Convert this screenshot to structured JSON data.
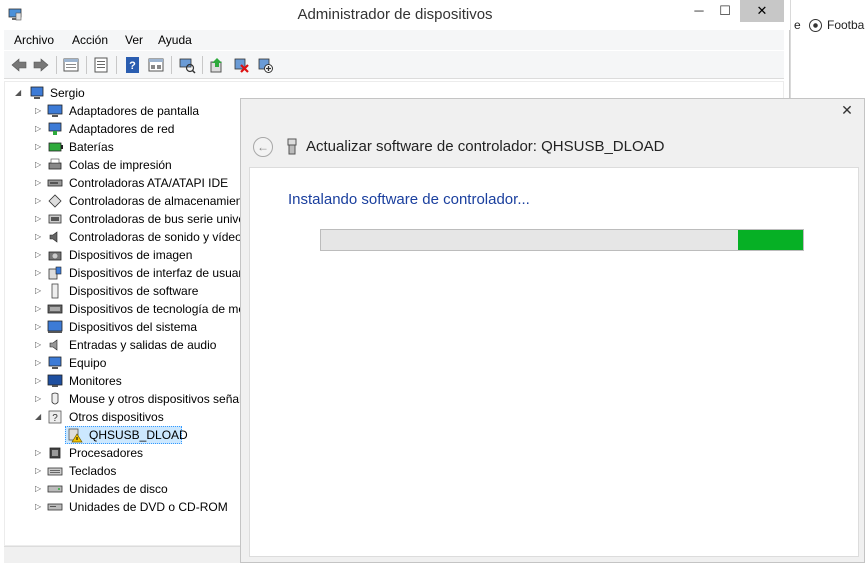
{
  "window": {
    "title": "Administrador de dispositivos",
    "min_glyph": "─",
    "max_glyph": "☐",
    "close_glyph": "✕"
  },
  "menu": [
    "Archivo",
    "Acción",
    "Ver",
    "Ayuda"
  ],
  "toolbar_icons": [
    "back-icon",
    "forward-icon",
    "properties-icon",
    "help-icon",
    "scan-hardware-icon",
    "update-driver-icon",
    "uninstall-icon",
    "disable-icon"
  ],
  "tree": {
    "root": "Sergio",
    "items": [
      {
        "label": "Adaptadores de pantalla",
        "icon": "display-adapter-icon"
      },
      {
        "label": "Adaptadores de red",
        "icon": "network-adapter-icon"
      },
      {
        "label": "Baterías",
        "icon": "battery-icon"
      },
      {
        "label": "Colas de impresión",
        "icon": "printer-icon"
      },
      {
        "label": "Controladoras ATA/ATAPI IDE",
        "icon": "ide-controller-icon"
      },
      {
        "label": "Controladoras de almacenamiento",
        "icon": "storage-controller-icon"
      },
      {
        "label": "Controladoras de bus serie universal",
        "icon": "usb-controller-icon"
      },
      {
        "label": "Controladoras de sonido y vídeo y dispositivos de juego",
        "icon": "sound-icon"
      },
      {
        "label": "Dispositivos de imagen",
        "icon": "camera-icon"
      },
      {
        "label": "Dispositivos de interfaz de usuario (HID)",
        "icon": "hid-icon"
      },
      {
        "label": "Dispositivos de software",
        "icon": "software-device-icon"
      },
      {
        "label": "Dispositivos de tecnología de memoria",
        "icon": "memory-tech-icon"
      },
      {
        "label": "Dispositivos del sistema",
        "icon": "system-device-icon"
      },
      {
        "label": "Entradas y salidas de audio",
        "icon": "speaker-icon"
      },
      {
        "label": "Equipo",
        "icon": "computer-icon"
      },
      {
        "label": "Monitores",
        "icon": "monitor-icon"
      },
      {
        "label": "Mouse y otros dispositivos señaladores",
        "icon": "mouse-icon"
      },
      {
        "label": "Otros dispositivos",
        "icon": "unknown-device-icon",
        "expanded": true
      },
      {
        "label": "QHSUSB_DLOAD",
        "icon": "warning-device-icon",
        "child": true,
        "selected": true
      },
      {
        "label": "Procesadores",
        "icon": "processor-icon"
      },
      {
        "label": "Teclados",
        "icon": "keyboard-icon"
      },
      {
        "label": "Unidades de disco",
        "icon": "disk-icon"
      },
      {
        "label": "Unidades de DVD o CD-ROM",
        "icon": "dvd-icon"
      }
    ]
  },
  "dialog": {
    "title": "Actualizar software de controlador: QHSUSB_DLOAD",
    "message": "Instalando software de controlador...",
    "close_glyph": "✕",
    "back_glyph": "←",
    "progress": {
      "segment_start": 0.866,
      "segment_end": 1.0
    }
  },
  "background_app": {
    "tab_fragment": "e",
    "tab_label": "Footba"
  },
  "colors": {
    "progress_fill": "#06b025",
    "message_text": "#1a3f9e",
    "selection": "#cce8ff"
  }
}
